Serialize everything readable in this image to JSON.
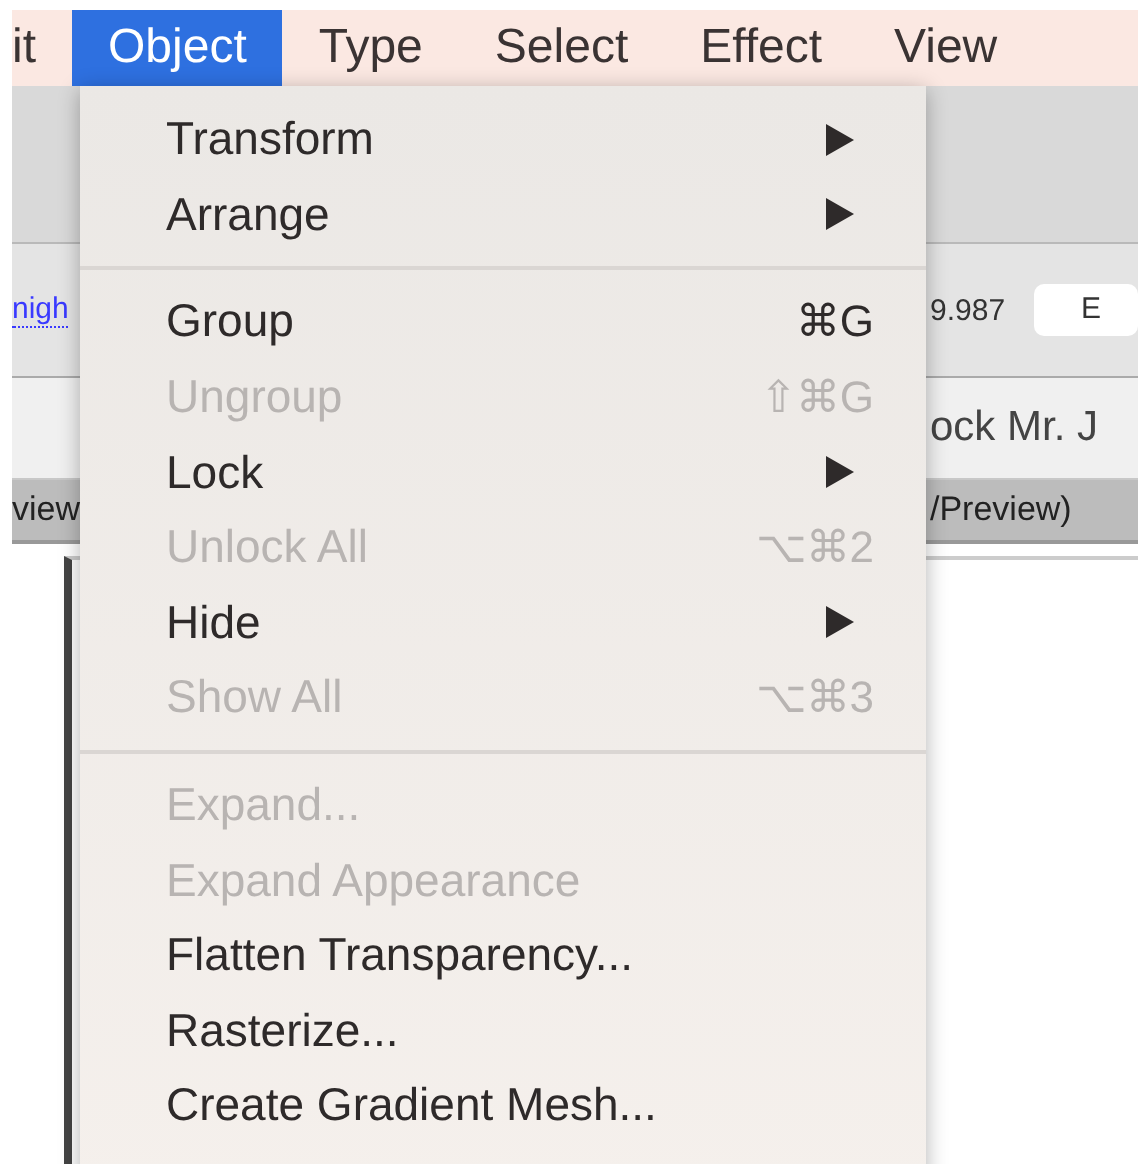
{
  "menubar": [
    {
      "label": "it",
      "selected": false
    },
    {
      "label": "Object",
      "selected": true
    },
    {
      "label": "Type",
      "selected": false
    },
    {
      "label": "Select",
      "selected": false
    },
    {
      "label": "Effect",
      "selected": false
    },
    {
      "label": "View",
      "selected": false
    }
  ],
  "control_bar": {
    "link": "nigh",
    "value": "9.987",
    "field": "E"
  },
  "document_tab": {
    "title": "ock Mr. J"
  },
  "view_strip": {
    "left": "view",
    "right": "/Preview)"
  },
  "menu": {
    "sections": [
      [
        {
          "label": "Transform",
          "kind": "submenu",
          "disabled": false
        },
        {
          "label": "Arrange",
          "kind": "submenu",
          "disabled": false
        }
      ],
      [
        {
          "label": "Group",
          "kind": "shortcut",
          "shortcut": "⌘G",
          "disabled": false
        },
        {
          "label": "Ungroup",
          "kind": "shortcut",
          "shortcut": "⇧⌘G",
          "disabled": true
        },
        {
          "label": "Lock",
          "kind": "submenu",
          "disabled": false
        },
        {
          "label": "Unlock All",
          "kind": "shortcut",
          "shortcut": "⌥⌘2",
          "disabled": true
        },
        {
          "label": "Hide",
          "kind": "submenu",
          "disabled": false
        },
        {
          "label": "Show All",
          "kind": "shortcut",
          "shortcut": "⌥⌘3",
          "disabled": true
        }
      ],
      [
        {
          "label": "Expand...",
          "kind": "plain",
          "disabled": true
        },
        {
          "label": "Expand Appearance",
          "kind": "plain",
          "disabled": true
        },
        {
          "label": "Flatten Transparency...",
          "kind": "plain",
          "disabled": false
        },
        {
          "label": "Rasterize...",
          "kind": "plain",
          "disabled": false
        },
        {
          "label": "Create Gradient Mesh...",
          "kind": "plain",
          "disabled": false
        }
      ]
    ]
  }
}
